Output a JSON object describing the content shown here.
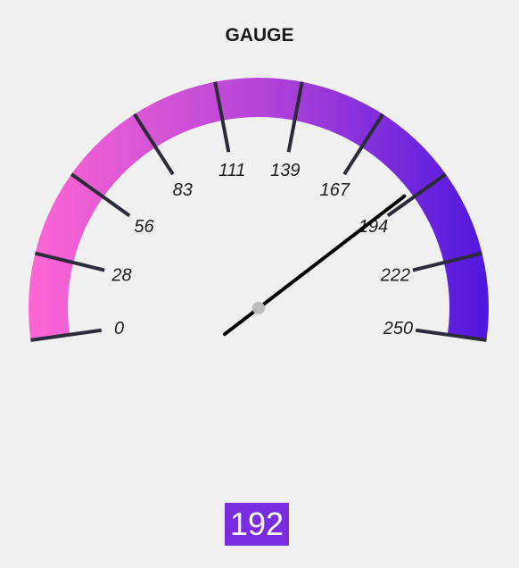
{
  "gauge": {
    "title": "GAUGE",
    "min": 0,
    "max": 250,
    "value": 192,
    "value_text": "192",
    "tick_labels": [
      "0",
      "28",
      "56",
      "83",
      "111",
      "139",
      "167",
      "194",
      "222",
      "250"
    ],
    "colors": {
      "arc_start": "#ff66d3",
      "arc_mid": "#b545d8",
      "arc_end": "#4f17df",
      "tick": "#2b2b3a",
      "needle": "#000000",
      "pivot": "#bdbdbd",
      "readout_bg": "#7a2ce0"
    }
  }
}
